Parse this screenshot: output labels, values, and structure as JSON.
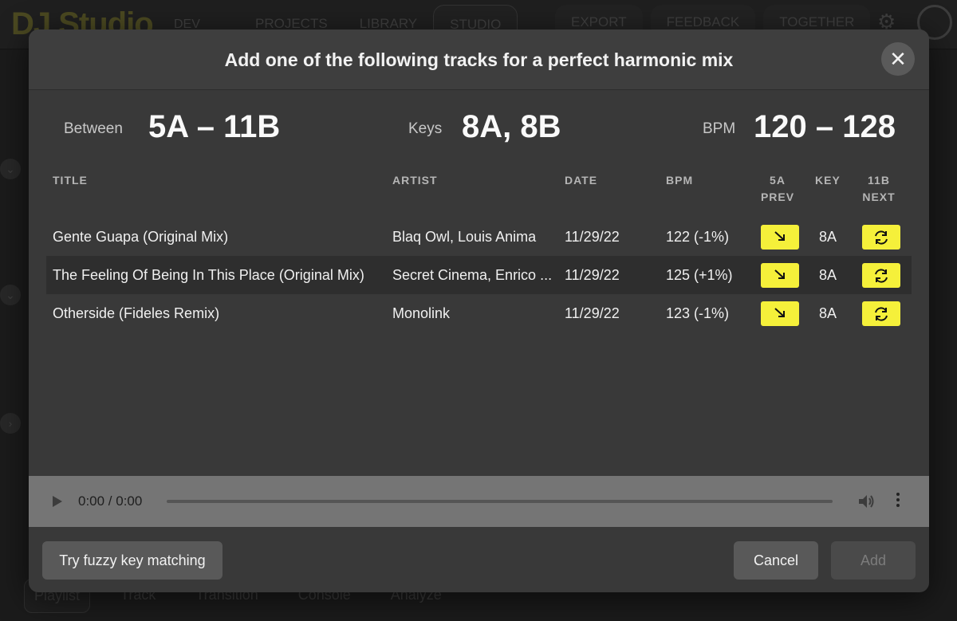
{
  "app": {
    "logo": "DJ Studio",
    "env_tag": "DEV",
    "nav": [
      "PROJECTS",
      "LIBRARY",
      "STUDIO"
    ],
    "nav_right": [
      "EXPORT",
      "FEEDBACK",
      "TOGETHER"
    ],
    "bottom_tabs": [
      "Playlist",
      "Track",
      "Transition",
      "Console",
      "Analyze"
    ]
  },
  "modal": {
    "title": "Add one of the following tracks for a perfect harmonic mix",
    "close_symbol": "✕",
    "stats": {
      "between_label": "Between",
      "between_value": "5A – 11B",
      "keys_label": "Keys",
      "keys_value": "8A, 8B",
      "bpm_label": "BPM",
      "bpm_value": "120 – 128"
    },
    "columns": {
      "title": "TITLE",
      "artist": "ARTIST",
      "date": "DATE",
      "bpm": "BPM",
      "prev_line1": "5A",
      "prev_line2": "PREV",
      "key": "KEY",
      "next_line1": "11B",
      "next_line2": "NEXT"
    },
    "rows": [
      {
        "title": "Gente Guapa (Original Mix)",
        "artist": "Blaq Owl, Louis Anima",
        "date": "11/29/22",
        "bpm": "122 (-1%)",
        "key": "8A"
      },
      {
        "title": "The Feeling Of Being In This Place (Original Mix)",
        "artist": "Secret Cinema, Enrico ...",
        "date": "11/29/22",
        "bpm": "125 (+1%)",
        "key": "8A"
      },
      {
        "title": "Otherside (Fideles Remix)",
        "artist": "Monolink",
        "date": "11/29/22",
        "bpm": "123 (-1%)",
        "key": "8A"
      }
    ],
    "player": {
      "time": "0:00 / 0:00",
      "progress": 0
    },
    "buttons": {
      "fuzzy": "Try fuzzy key matching",
      "cancel": "Cancel",
      "add": "Add"
    }
  },
  "colors": {
    "accent_yellow": "#f5f03a",
    "modal_bg": "#393939",
    "alt_row": "#2e2e2e"
  }
}
